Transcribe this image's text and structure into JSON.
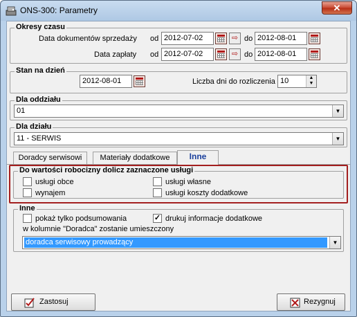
{
  "window": {
    "title": "ONS-300: Parametry",
    "close_glyph": "✕"
  },
  "periods": {
    "title": "Okresy czasu",
    "sales_label": "Data dokumentów sprzedaży",
    "payment_label": "Data zapłaty",
    "from_label": "od",
    "to_label": "do",
    "sales_from": "2012-07-02",
    "sales_to": "2012-08-01",
    "payment_from": "2012-07-02",
    "payment_to": "2012-08-01",
    "copy_glyph": "⇨"
  },
  "state": {
    "title": "Stan na dzień",
    "date": "2012-08-01",
    "days_label": "Liczba dni do rozliczenia",
    "days_value": "10",
    "spin_up": "▲",
    "spin_down": "▼"
  },
  "branch": {
    "title": "Dla oddziału",
    "value": "01"
  },
  "department": {
    "title": "Dla działu",
    "value": "11 - SERWIS"
  },
  "tabs": [
    {
      "label": "Doradcy serwisowi",
      "active": false
    },
    {
      "label": "Materiały dodatkowe",
      "active": false
    },
    {
      "label": "Inne",
      "active": true
    }
  ],
  "labor_services": {
    "title": "Do wartości robocizny dolicz zaznaczone usługi",
    "options": [
      {
        "label": "usługi obce",
        "checked": false
      },
      {
        "label": "usługi własne",
        "checked": false
      },
      {
        "label": "wynajem",
        "checked": false
      },
      {
        "label": "usługi koszty dodatkowe",
        "checked": false
      }
    ]
  },
  "other": {
    "title": "Inne",
    "summary_only": {
      "label": "pokaż tylko podsumowania",
      "checked": false
    },
    "print_info": {
      "label": "drukuj informacje dodatkowe",
      "checked": true
    },
    "advisor_column_label": "w kolumnie \"Doradca\" zostanie umieszczony",
    "advisor_select_value": "doradca serwisowy prowadzący"
  },
  "buttons": {
    "apply_label": "Zastosuj",
    "cancel_label": "Rezygnuj"
  },
  "dropdown_glyph": "▼",
  "check_glyph": "✓",
  "colors": {
    "highlight": "#a31e1e",
    "selection": "#3399ff",
    "active_tab": "#1a3f9c"
  }
}
